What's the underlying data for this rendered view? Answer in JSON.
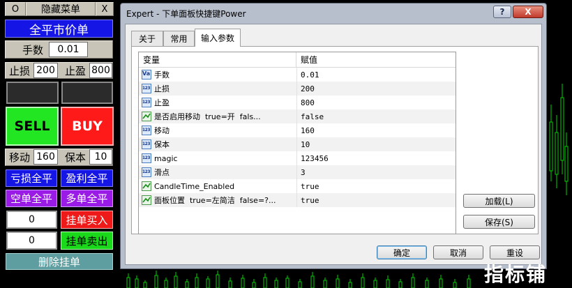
{
  "panel": {
    "header": {
      "o": "O",
      "title": "隐藏菜单",
      "x": "X"
    },
    "close_all_market": "全平市价单",
    "lots_label": "手数",
    "lots_value": "0.01",
    "sl_label": "止损",
    "sl_value": "200",
    "tp_label": "止盈",
    "tp_value": "800",
    "sell": "SELL",
    "buy": "BUY",
    "trail_label": "移动",
    "trail_value": "160",
    "be_label": "保本",
    "be_value": "10",
    "close_loss": "亏损全平",
    "close_profit": "盈利全平",
    "close_sell": "空单全平",
    "close_buy": "多单全平",
    "pending_buy_value": "0",
    "pending_buy": "挂单买入",
    "pending_sell_value": "0",
    "pending_sell": "挂单卖出",
    "delete_pending": "删除挂单"
  },
  "dialog": {
    "title": "Expert - 下单面板快捷键Power",
    "help_button": "?",
    "close_button": "X",
    "tabs": [
      "关于",
      "常用",
      "输入参数"
    ],
    "active_tab": "输入参数",
    "columns": {
      "name": "变量",
      "value": "赋值"
    },
    "rows": [
      {
        "icon": "Va",
        "name": "手数",
        "value": "0.01"
      },
      {
        "icon": "123",
        "name": "止损",
        "value": "200"
      },
      {
        "icon": "123",
        "name": "止盈",
        "value": "800"
      },
      {
        "icon": "bool",
        "name": "是否启用移动  true=开  fals...",
        "value": "false"
      },
      {
        "icon": "123",
        "name": "移动",
        "value": "160"
      },
      {
        "icon": "123",
        "name": "保本",
        "value": "10"
      },
      {
        "icon": "123",
        "name": "magic",
        "value": "123456"
      },
      {
        "icon": "123",
        "name": "滑点",
        "value": "3"
      },
      {
        "icon": "bool",
        "name": "CandleTime_Enabled",
        "value": "true"
      },
      {
        "icon": "bool",
        "name": "面板位置  true=左简洁  false=?...",
        "value": "true"
      }
    ],
    "load_button": "加载(L)",
    "save_button": "保存(S)",
    "ok_button": "确定",
    "cancel_button": "取消",
    "reset_button": "重设"
  },
  "watermark": "指标铺",
  "colors": {
    "blue_button": "#1515e6",
    "sell_green": "#22e622",
    "buy_red": "#ff1a1a",
    "purple": "#9a1ae6",
    "pending_buy_red": "#ee1a1a",
    "pending_sell_green": "#1ad81a",
    "delete_teal": "#5e9ea0",
    "candle_green": "#00d200"
  }
}
